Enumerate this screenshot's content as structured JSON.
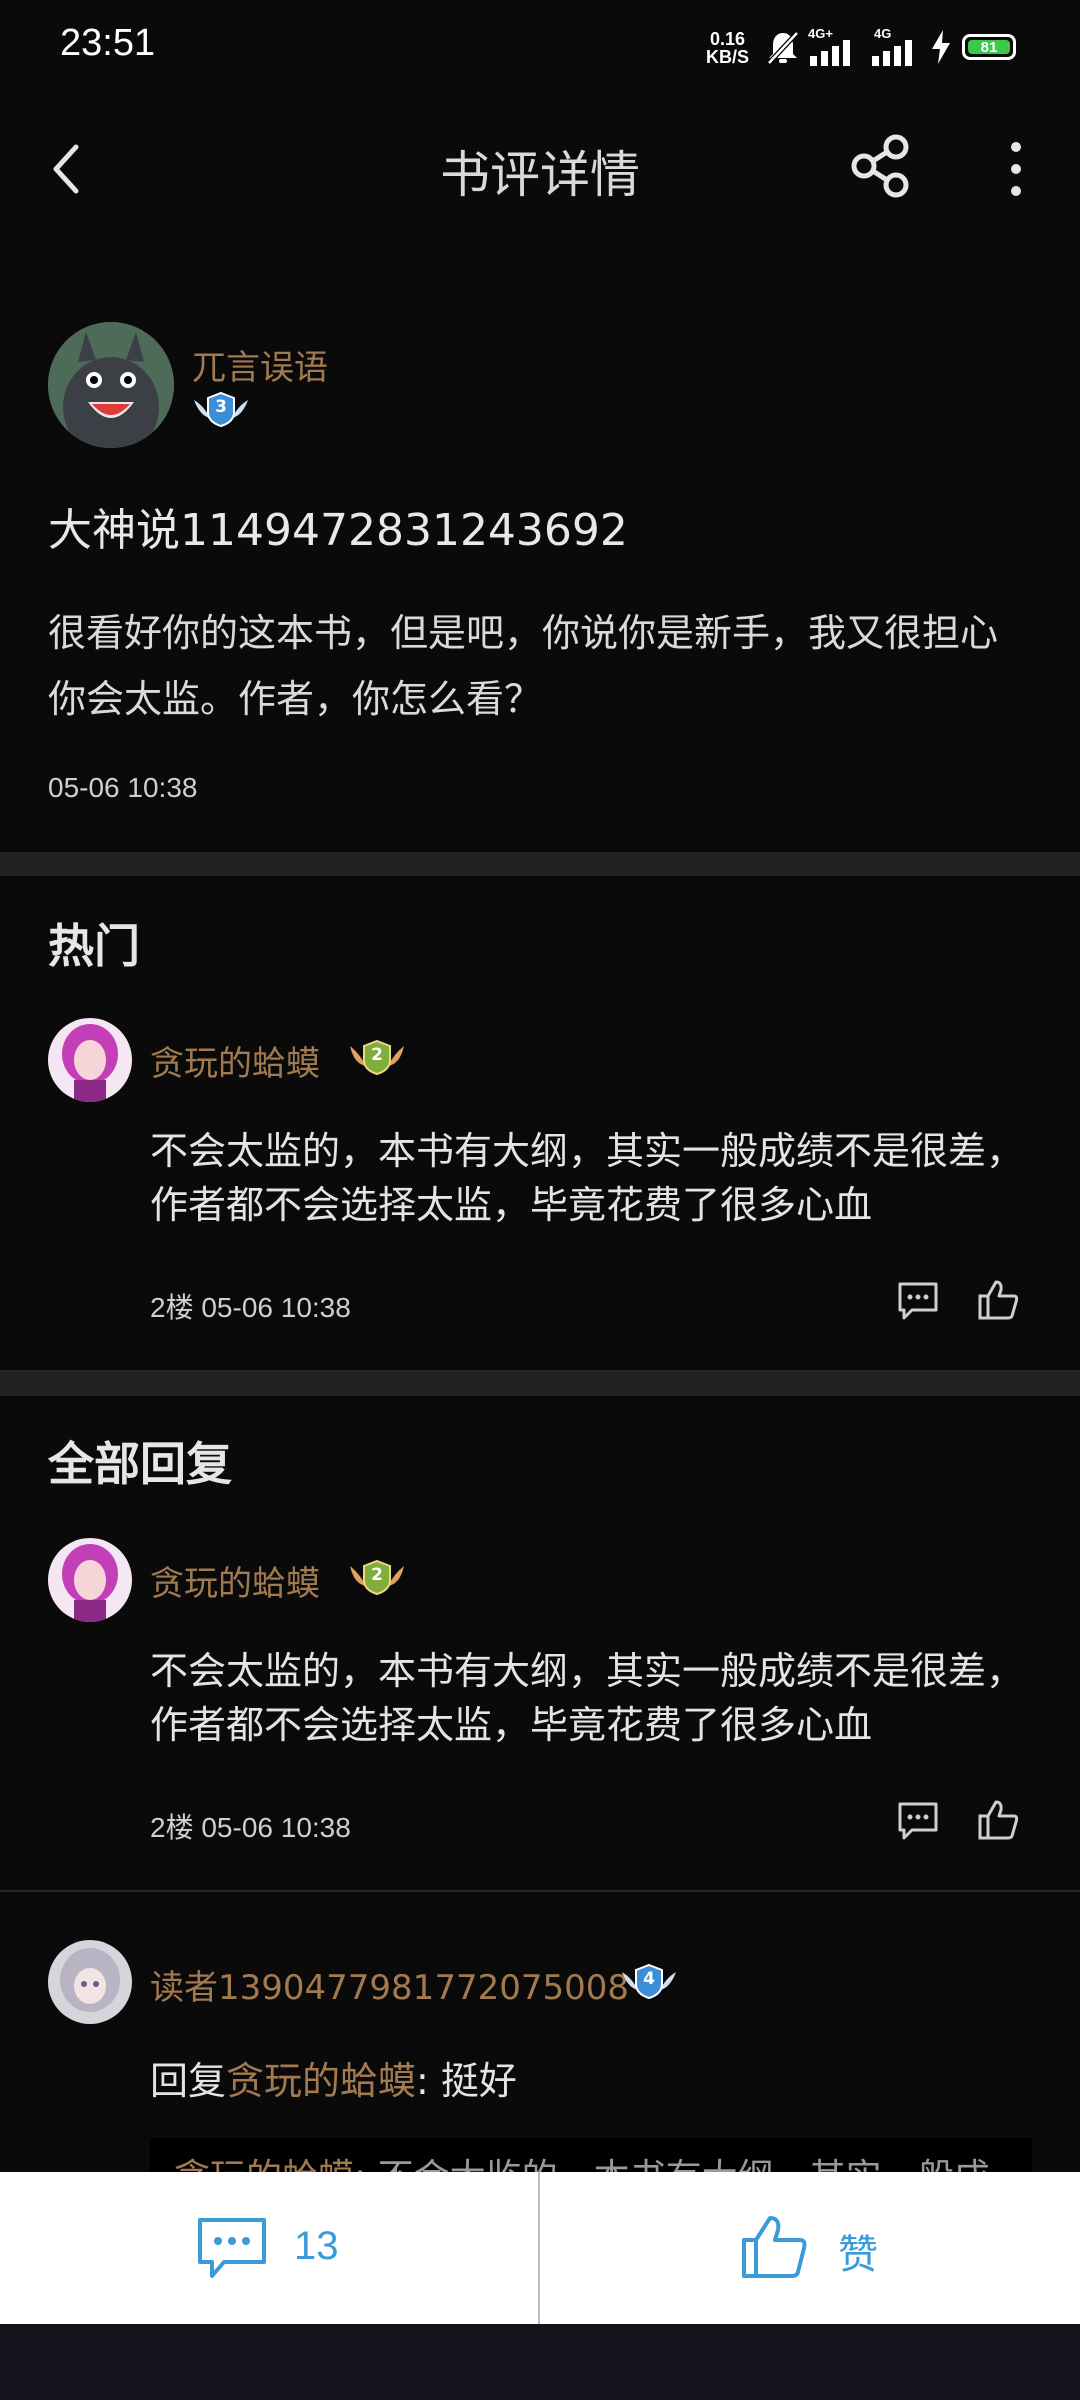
{
  "status_bar": {
    "time": "23:51",
    "net_speed_value": "0.16",
    "net_speed_unit": "KB/S",
    "signal1_label": "4G+",
    "signal2_label": "4G",
    "battery": "81"
  },
  "header": {
    "title": "书评详情"
  },
  "review": {
    "author": "兀言误语",
    "level": "3",
    "title": "大神说1149472831243692",
    "content": "很看好你的这本书，但是吧，你说你是新手，我又很担心你会太监。作者，你怎么看？",
    "time": "05-06 10:38"
  },
  "hot": {
    "section_title": "热门",
    "items": [
      {
        "user": "贪玩的蛤蟆",
        "level": "2",
        "content": "不会太监的，本书有大纲，其实一般成绩不是很差，作者都不会选择太监，毕竟花费了很多心血",
        "meta": "2楼 05-06 10:38"
      }
    ]
  },
  "all": {
    "section_title": "全部回复",
    "items": [
      {
        "user": "贪玩的蛤蟆",
        "level": "2",
        "content": "不会太监的，本书有大纲，其实一般成绩不是很差，作者都不会选择太监，毕竟花费了很多心血",
        "meta": "2楼 05-06 10:38"
      },
      {
        "user": "读者1390477981772075008",
        "level": "4",
        "reply_prefix": "回复",
        "reply_to": "贪玩的蛤蟆",
        "reply_suffix": ": 挺好",
        "quote_user": "贪玩的蛤蟆",
        "quote_text": ": 不会太监的，本书有大纲，其实一般成"
      }
    ]
  },
  "bottom_bar": {
    "comment_count": "13",
    "like_label": "赞"
  },
  "colors": {
    "background": "#0a0a0a",
    "username": "#a27a4f",
    "accent_blue": "#3a9bd8",
    "battery": "#3cc84a"
  }
}
